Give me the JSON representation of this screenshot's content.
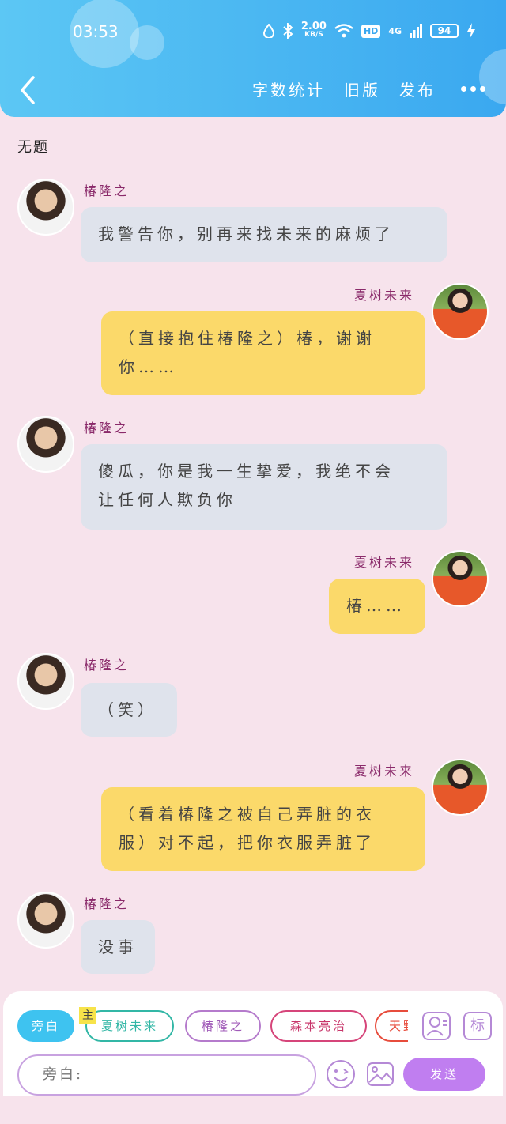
{
  "status_bar": {
    "time": "03:53",
    "net_speed_value": "2.00",
    "net_speed_unit": "KB/S",
    "hd": "HD",
    "signal": "4G",
    "battery": "94"
  },
  "nav": {
    "word_count": "字数统计",
    "old_version": "旧版",
    "publish": "发布"
  },
  "title": "无题",
  "messages": [
    {
      "speaker": "椿隆之",
      "side": "left",
      "lines": [
        "我警告你，别再来找未来的麻烦了"
      ]
    },
    {
      "speaker": "夏树未来",
      "side": "right",
      "lines": [
        "（直接抱住椿隆之）椿，谢谢",
        "你……"
      ]
    },
    {
      "speaker": "椿隆之",
      "side": "left",
      "lines": [
        "傻瓜，你是我一生挚爱，我绝不会",
        "让任何人欺负你"
      ]
    },
    {
      "speaker": "夏树未来",
      "side": "right",
      "lines": [
        "椿……"
      ]
    },
    {
      "speaker": "椿隆之",
      "side": "left",
      "lines": [
        "（笑）"
      ]
    },
    {
      "speaker": "夏树未来",
      "side": "right",
      "lines": [
        "（看着椿隆之被自己弄脏的衣",
        "服）对不起，把你衣服弄脏了"
      ]
    },
    {
      "speaker": "椿隆之",
      "side": "left",
      "lines": [
        "没事"
      ]
    }
  ],
  "composer": {
    "chips": [
      "旁白",
      "夏树未来",
      "椿隆之",
      "森本亮治",
      "天野"
    ],
    "main_tag": "主",
    "tag_icon": "标",
    "input_placeholder": "旁白:",
    "send": "发送"
  }
}
